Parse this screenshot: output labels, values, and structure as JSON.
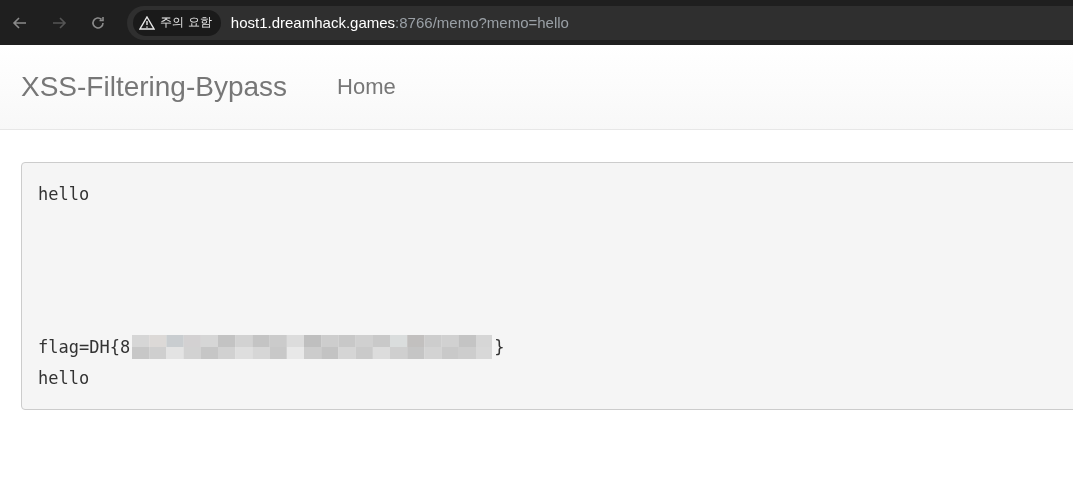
{
  "browser": {
    "security_badge": "주의 요함",
    "url_host": "host1.dreamhack.games",
    "url_rest": ":8766/memo?memo=hello"
  },
  "navbar": {
    "brand": "XSS-Filtering-Bypass",
    "links": [
      {
        "label": "Home"
      }
    ]
  },
  "memo": {
    "lines": [
      {
        "kind": "text",
        "text": "hello"
      },
      {
        "kind": "blank"
      },
      {
        "kind": "blank"
      },
      {
        "kind": "blank"
      },
      {
        "kind": "blank"
      },
      {
        "kind": "redacted",
        "prefix": "flag=DH{8",
        "suffix": "}"
      },
      {
        "kind": "text",
        "text": "hello"
      }
    ]
  }
}
